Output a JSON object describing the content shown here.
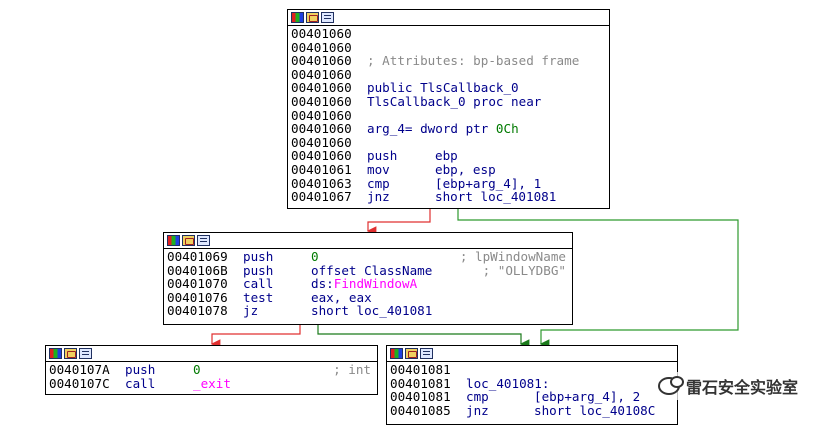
{
  "node_a": {
    "lines": [
      {
        "addr": "00401060",
        "text": ""
      },
      {
        "addr": "00401060",
        "text": ""
      },
      {
        "addr": "00401060",
        "comment": "; Attributes: bp-based frame"
      },
      {
        "addr": "00401060",
        "text": ""
      },
      {
        "addr": "00401060",
        "label": "public TlsCallback_0"
      },
      {
        "addr": "00401060",
        "label": "TlsCallback_0 proc near"
      },
      {
        "addr": "00401060",
        "text": ""
      },
      {
        "addr": "00401060",
        "label": "arg_4= dword ptr",
        "num": " 0Ch"
      },
      {
        "addr": "00401060",
        "text": ""
      },
      {
        "addr": "00401060",
        "mn": "push",
        "op": "ebp"
      },
      {
        "addr": "00401061",
        "mn": "mov",
        "op": "ebp, esp"
      },
      {
        "addr": "00401063",
        "mn": "cmp",
        "op": "[ebp+arg_4], 1"
      },
      {
        "addr": "00401067",
        "mn": "jnz",
        "op": "short loc_401081"
      }
    ]
  },
  "node_b": {
    "lines": [
      {
        "addr": "00401069",
        "mn": "push",
        "num": "0",
        "comment": "; lpWindowName"
      },
      {
        "addr": "0040106B",
        "mn": "push",
        "op": "offset ClassName",
        "comment": "; \"OLLYDBG\""
      },
      {
        "addr": "00401070",
        "mn": "call",
        "op": "ds:",
        "imp": "FindWindowA"
      },
      {
        "addr": "00401076",
        "mn": "test",
        "op": "eax, eax"
      },
      {
        "addr": "00401078",
        "mn": "jz",
        "op": "short loc_401081"
      }
    ]
  },
  "node_c": {
    "lines": [
      {
        "addr": "0040107A",
        "mn": "push",
        "num": "0",
        "comment": "; int"
      },
      {
        "addr": "0040107C",
        "mn": "call",
        "imp": "_exit"
      }
    ]
  },
  "node_d": {
    "lines": [
      {
        "addr": "00401081",
        "text": ""
      },
      {
        "addr": "00401081",
        "label": "loc_401081:"
      },
      {
        "addr": "00401081",
        "mn": "cmp",
        "op": "[ebp+arg_4], 2"
      },
      {
        "addr": "00401085",
        "mn": "jnz",
        "op": "short loc_40108C"
      }
    ]
  },
  "watermark": {
    "text": "雷石安全实验室",
    "icon": "wechat-icon"
  },
  "colors": {
    "edge_false": "#e03030",
    "edge_true": "#2e9a2e",
    "edge_uncond": "#1a7a1a"
  }
}
